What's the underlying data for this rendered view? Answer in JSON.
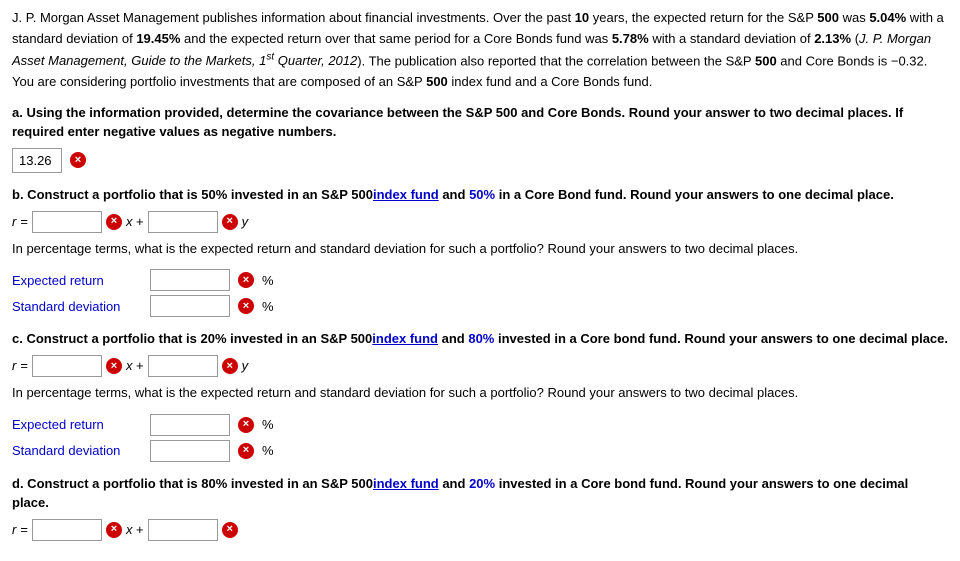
{
  "main_paragraph": {
    "text_parts": [
      "J. P. Morgan Asset Management publishes information about financial investments. Over the past ",
      "10",
      " years, ",
      "the expected",
      " return for the S&P ",
      "500",
      " was ",
      "5.04%",
      " with a standard deviation of ",
      "19.45%",
      " and the expected return over that same period for a Core Bonds fund was ",
      "5.78%",
      " with a standard deviation of ",
      "2.13%",
      " (J. P. Morgan Asset Management, Guide to the Markets, 1",
      "st",
      " Quarter, 2012). The publication also reported that the correlation between the S&P ",
      "500",
      " and Core Bonds is −0.32. You are considering portfolio investments that are composed of an S&P ",
      "500",
      " index fund and a Core Bonds fund."
    ]
  },
  "question_a": {
    "label": "a.",
    "text": "Using the information provided, determine the covariance between the S&P ",
    "sp500": "500",
    "text2": " and Core Bonds. Round your answer to two decimal places. If required enter negative values as negative numbers.",
    "answer_value": "13.26"
  },
  "question_b": {
    "label": "b.",
    "text_pre": "Construct a portfolio that is ",
    "pct1": "50%",
    "text_mid1": " invested in an S&P ",
    "sp500": "500",
    "text_mid2": "index fund",
    "text_mid3": " and ",
    "pct2": "50%",
    "text_mid4": " in a Core Bond fund. Round your answers to one decimal place.",
    "r_label": "r =",
    "x_label": "x +",
    "y_label": "y",
    "followup": "In percentage terms, what is the expected return and standard deviation for such a portfolio? Round your answers to two decimal places.",
    "expected_return_label": "Expected return",
    "standard_deviation_label": "Standard deviation",
    "pct_symbol": "%"
  },
  "question_c": {
    "label": "c.",
    "text_pre": "Construct a portfolio that is ",
    "pct1": "20%",
    "text_mid1": " invested in an S&P ",
    "sp500": "500",
    "text_mid2": "index fund",
    "text_mid3": " and ",
    "pct2": "80%",
    "text_mid4": " invested in a Core bond fund. Round your answers to one decimal place.",
    "r_label": "r =",
    "x_label": "x +",
    "y_label": "y",
    "followup": "In percentage terms, what is the expected return and standard deviation for such a portfolio? Round your answers to two decimal places.",
    "expected_return_label": "Expected return",
    "standard_deviation_label": "Standard deviation",
    "pct_symbol": "%"
  },
  "question_d": {
    "label": "d.",
    "text_pre": "Construct a portfolio that is ",
    "pct1": "80%",
    "text_mid1": " invested in an S&P ",
    "sp500": "500",
    "text_mid2": "index fund",
    "text_mid3": " and ",
    "pct2": "20%",
    "text_mid4": " invested in a Core bond fund. Round your answers to one decimal place."
  },
  "icons": {
    "error": "×"
  }
}
